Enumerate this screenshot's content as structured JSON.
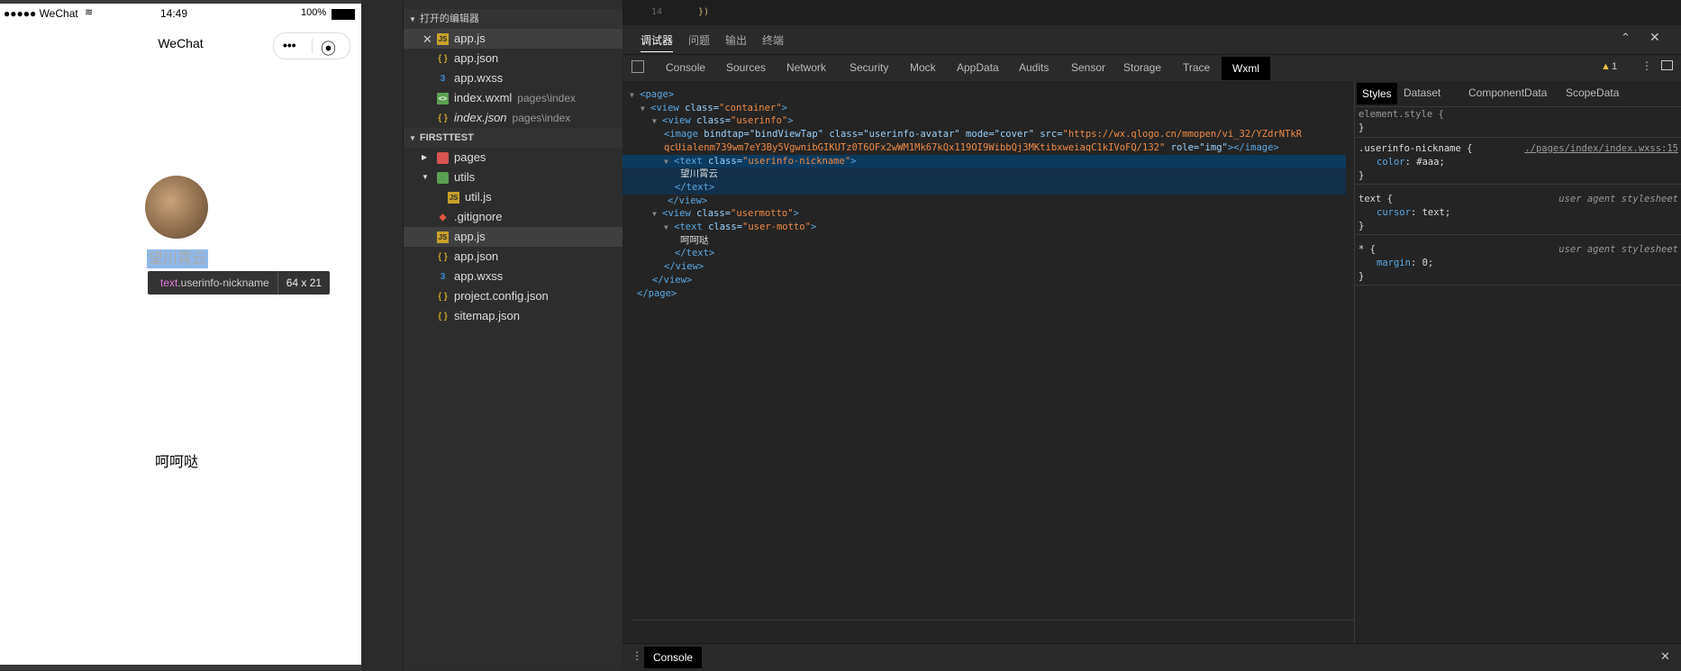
{
  "simulator": {
    "status": {
      "signal": "●●●●● WeChat",
      "time": "14:49",
      "battery": "100%"
    },
    "nav_title": "WeChat",
    "capsule_more": "•••",
    "capsule_close": "⦿",
    "nickname": "望川霄云",
    "tooltip_tag": "text",
    "tooltip_class": ".userinfo-nickname",
    "tooltip_size": "64 x 21",
    "motto": "呵呵哒"
  },
  "explorer": {
    "open_editors_title": "打开的编辑器",
    "project_title": "FIRSTTEST",
    "open_files": [
      {
        "name": "app.js",
        "dir": ""
      },
      {
        "name": "app.json",
        "dir": ""
      },
      {
        "name": "app.wxss",
        "dir": ""
      },
      {
        "name": "index.wxml",
        "dir": "pages\\index"
      },
      {
        "name": "index.json",
        "dir": "pages\\index"
      }
    ],
    "tree": [
      {
        "name": "pages"
      },
      {
        "name": "utils"
      },
      {
        "name": "util.js"
      },
      {
        "name": ".gitignore"
      },
      {
        "name": "app.js"
      },
      {
        "name": "app.json"
      },
      {
        "name": "app.wxss"
      },
      {
        "name": "project.config.json"
      },
      {
        "name": "sitemap.json"
      }
    ]
  },
  "editor": {
    "line_no": "14",
    "code": "})"
  },
  "devtools": {
    "top_tabs": [
      "调试器",
      "问题",
      "输出",
      "终端"
    ],
    "panel_tabs": [
      "Console",
      "Sources",
      "Network",
      "Security",
      "Mock",
      "AppData",
      "Audits",
      "Sensor",
      "Storage",
      "Trace",
      "Wxml"
    ],
    "warning_count": "1",
    "wxml": {
      "page_open": "<page>",
      "view_container_tag": "<view",
      "view_container_attr": "class=",
      "view_container_val": "\"container\"",
      "view_userinfo_tag": "<view",
      "view_userinfo_attr": "class=",
      "view_userinfo_val": "\"userinfo\"",
      "image_line1_tag": "<image",
      "image_line1_attrs": "bindtap=\"bindViewTap\" class=\"userinfo-avatar\" mode=\"cover\" src=",
      "image_line1_src": "\"https://wx.qlogo.cn/mmopen/vi_32/YZdrNTkR",
      "image_line2_src": "qcUialenm739wm7eY3By5VgwnibGIKUTz0T6OFx2wWM1Mk67kQx119OI9WibbQj3MKtibxweiaqC1kIVoFQ/132\"",
      "image_line2_role": "role=\"img\"",
      "image_line2_close": "></image>",
      "text_nick_tag": "<text",
      "text_nick_attr": "class=",
      "text_nick_val": "\"userinfo-nickname\"",
      "nickname_text": "望川霄云",
      "text_close": "</text>",
      "view_close": "</view>",
      "view_usermotto_tag": "<view",
      "view_usermotto_attr": "class=",
      "view_usermotto_val": "\"usermotto\"",
      "text_motto_tag": "<text",
      "text_motto_attr": "class=",
      "text_motto_val": "\"user-motto\"",
      "motto_text": "呵呵哒",
      "page_close": "</page>"
    },
    "styles_tabs": [
      "Styles",
      "Dataset",
      "ComponentData",
      "ScopeData"
    ],
    "rules": {
      "element_selector": "element.style {",
      "close": "}",
      "nick_selector": ".userinfo-nickname {",
      "nick_src": "./pages/index/index.wxss:15",
      "nick_prop": "color",
      "nick_val": "#aaa;",
      "text_selector": "text {",
      "ua_src": "user agent stylesheet",
      "text_prop": "cursor",
      "text_val": "text;",
      "star_selector": "* {",
      "star_prop": "margin",
      "star_val": "0;"
    },
    "console_tab": "Console"
  }
}
